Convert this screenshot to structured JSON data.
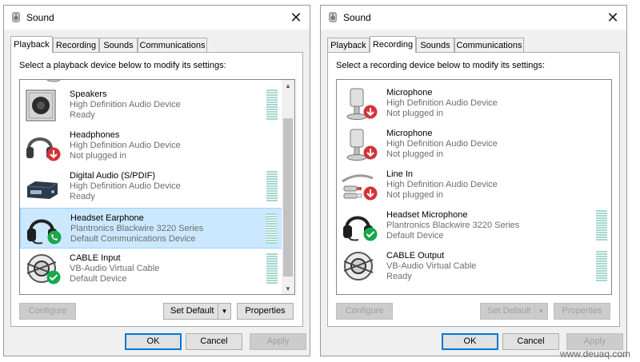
{
  "dialogs": [
    {
      "title": "Sound",
      "close_label": "✕",
      "tabs": [
        {
          "label": "Playback",
          "active": true
        },
        {
          "label": "Recording",
          "active": false
        },
        {
          "label": "Sounds",
          "active": false
        },
        {
          "label": "Communications",
          "active": false
        }
      ],
      "instruction": "Select a playback device below to modify its settings:",
      "devices": [
        {
          "name": "Speakers",
          "line2": "High Definition Audio Device",
          "line3": "Ready",
          "icon": "speaker-icon",
          "status": "none",
          "meter": true
        },
        {
          "name": "Headphones",
          "line2": "High Definition Audio Device",
          "line3": "Not plugged in",
          "icon": "headphones-icon",
          "status": "unplugged",
          "meter": false
        },
        {
          "name": "Digital Audio (S/PDIF)",
          "line2": "High Definition Audio Device",
          "line3": "Ready",
          "icon": "digital-audio-icon",
          "status": "none",
          "meter": true
        },
        {
          "name": "Headset Earphone",
          "line2": "Plantronics Blackwire 3220 Series",
          "line3": "Default Communications Device",
          "icon": "headset-icon",
          "status": "comms",
          "meter": true,
          "selected": true
        },
        {
          "name": "CABLE Input",
          "line2": "VB-Audio Virtual Cable",
          "line3": "Default Device",
          "icon": "cable-icon",
          "status": "default",
          "meter": true
        }
      ],
      "buttons": {
        "configure": "Configure",
        "set_default": "Set Default",
        "properties": "Properties",
        "ok": "OK",
        "cancel": "Cancel",
        "apply": "Apply"
      }
    },
    {
      "title": "Sound",
      "close_label": "✕",
      "tabs": [
        {
          "label": "Playback",
          "active": false
        },
        {
          "label": "Recording",
          "active": true
        },
        {
          "label": "Sounds",
          "active": false
        },
        {
          "label": "Communications",
          "active": false
        }
      ],
      "instruction": "Select a recording device below to modify its settings:",
      "devices": [
        {
          "name": "Microphone",
          "line2": "High Definition Audio Device",
          "line3": "Not plugged in",
          "icon": "microphone-icon",
          "status": "unplugged",
          "meter": false
        },
        {
          "name": "Microphone",
          "line2": "High Definition Audio Device",
          "line3": "Not plugged in",
          "icon": "microphone-icon",
          "status": "unplugged",
          "meter": false
        },
        {
          "name": "Line In",
          "line2": "High Definition Audio Device",
          "line3": "Not plugged in",
          "icon": "line-in-icon",
          "status": "unplugged",
          "meter": false
        },
        {
          "name": "Headset Microphone",
          "line2": "Plantronics Blackwire 3220 Series",
          "line3": "Default Device",
          "icon": "headset-icon",
          "status": "default",
          "meter": true
        },
        {
          "name": "CABLE Output",
          "line2": "VB-Audio Virtual Cable",
          "line3": "Ready",
          "icon": "cable-icon",
          "status": "none",
          "meter": true
        }
      ],
      "buttons": {
        "configure": "Configure",
        "set_default": "Set Default",
        "properties": "Properties",
        "ok": "OK",
        "cancel": "Cancel",
        "apply": "Apply"
      }
    }
  ],
  "watermark": "www.deuaq.com",
  "colors": {
    "selection": "#cce8ff",
    "default_check": "#16a84a",
    "unplugged_arrow": "#d13438",
    "meter": "#a6d8cf",
    "focus_border": "#0078d7"
  }
}
